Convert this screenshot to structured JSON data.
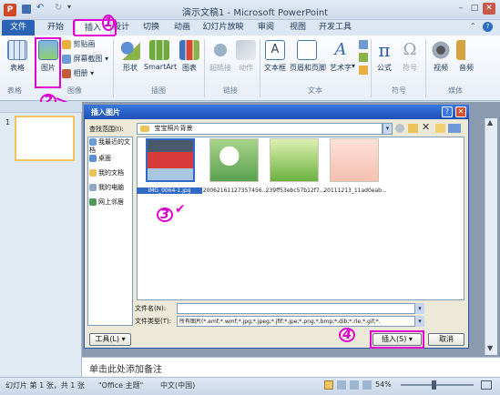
{
  "window": {
    "title": "演示文稿1 - Microsoft PowerPoint"
  },
  "tabs": [
    "文件",
    "开始",
    "插入",
    "设计",
    "切换",
    "动画",
    "幻灯片放映",
    "审阅",
    "视图",
    "开发工具"
  ],
  "ribbon": {
    "table": "表格",
    "picture": "图片",
    "clipart": "剪贴画",
    "screenshot": "屏幕截图",
    "album": "相册",
    "shapes": "形状",
    "smartart": "SmartArt",
    "chart": "图表",
    "hyperlink": "超链接",
    "action": "动作",
    "textbox": "文本框",
    "header": "页眉和页脚",
    "wordart": "艺术字",
    "formula": "公式",
    "symbol": "符号",
    "video": "视频",
    "audio": "音频",
    "groups": {
      "tables": "表格",
      "images": "图像",
      "illustrations": "插图",
      "links": "链接",
      "text": "文本",
      "symbols": "符号",
      "media": "媒体"
    }
  },
  "slide_number": "1",
  "notes_placeholder": "单击此处添加备注",
  "status": {
    "slide": "幻灯片 第 1 张，共 1 张",
    "theme": "\"Office 主题\"",
    "lang": "中文(中国)",
    "zoom": "54%"
  },
  "dialog": {
    "title": "插入图片",
    "lookin_label": "查找范围(I):",
    "lookin_value": "宝宝照片背景",
    "nav": [
      "我最近的文档",
      "桌面",
      "我的文档",
      "我的电脑",
      "网上邻居"
    ],
    "files": [
      "IMG_0064-1.jpg",
      "20062161127357456...",
      "239ff53ebc57b12f7...",
      "20111213_11ad0eab..."
    ],
    "filename_label": "文件名(N):",
    "filetype_label": "文件类型(T):",
    "filetype_value": "所有图片(*.emf;*.wmf;*.jpg;*.jpeg;*.jfif;*.jpe;*.png;*.bmp;*.dib;*.rle;*.gif;*.",
    "tools": "工具(L)",
    "insert": "插入(S)",
    "cancel": "取消"
  },
  "annotations": [
    "1",
    "2",
    "3",
    "4"
  ],
  "colors": {
    "file_tab": "#2a63b5",
    "dialog_title": "#1e4fb5",
    "annotation": "#e000d0"
  }
}
